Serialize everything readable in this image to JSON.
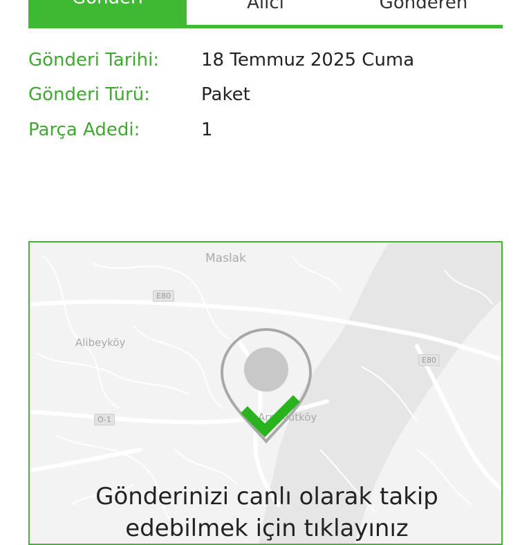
{
  "tabs": [
    {
      "label": "Gönderi"
    },
    {
      "label": "Alıcı"
    },
    {
      "label": "Gönderen"
    }
  ],
  "details": [
    {
      "label": "Gönderi Tarihi:",
      "value": "18 Temmuz 2025 Cuma"
    },
    {
      "label": "Gönderi Türü:",
      "value": "Paket"
    },
    {
      "label": "Parça Adedi:",
      "value": "1"
    }
  ],
  "map": {
    "places": [
      "Maslak",
      "Alibeyköy",
      "Arnavutköy"
    ],
    "road_shields": [
      "E80",
      "E80",
      "O-1"
    ],
    "track_text_line1": "Gönderinizi canlı olarak takip",
    "track_text_line2": "edebilmek için tıklayınız"
  },
  "colors": {
    "accent": "#3fb833",
    "label_green": "#3fa82f"
  }
}
